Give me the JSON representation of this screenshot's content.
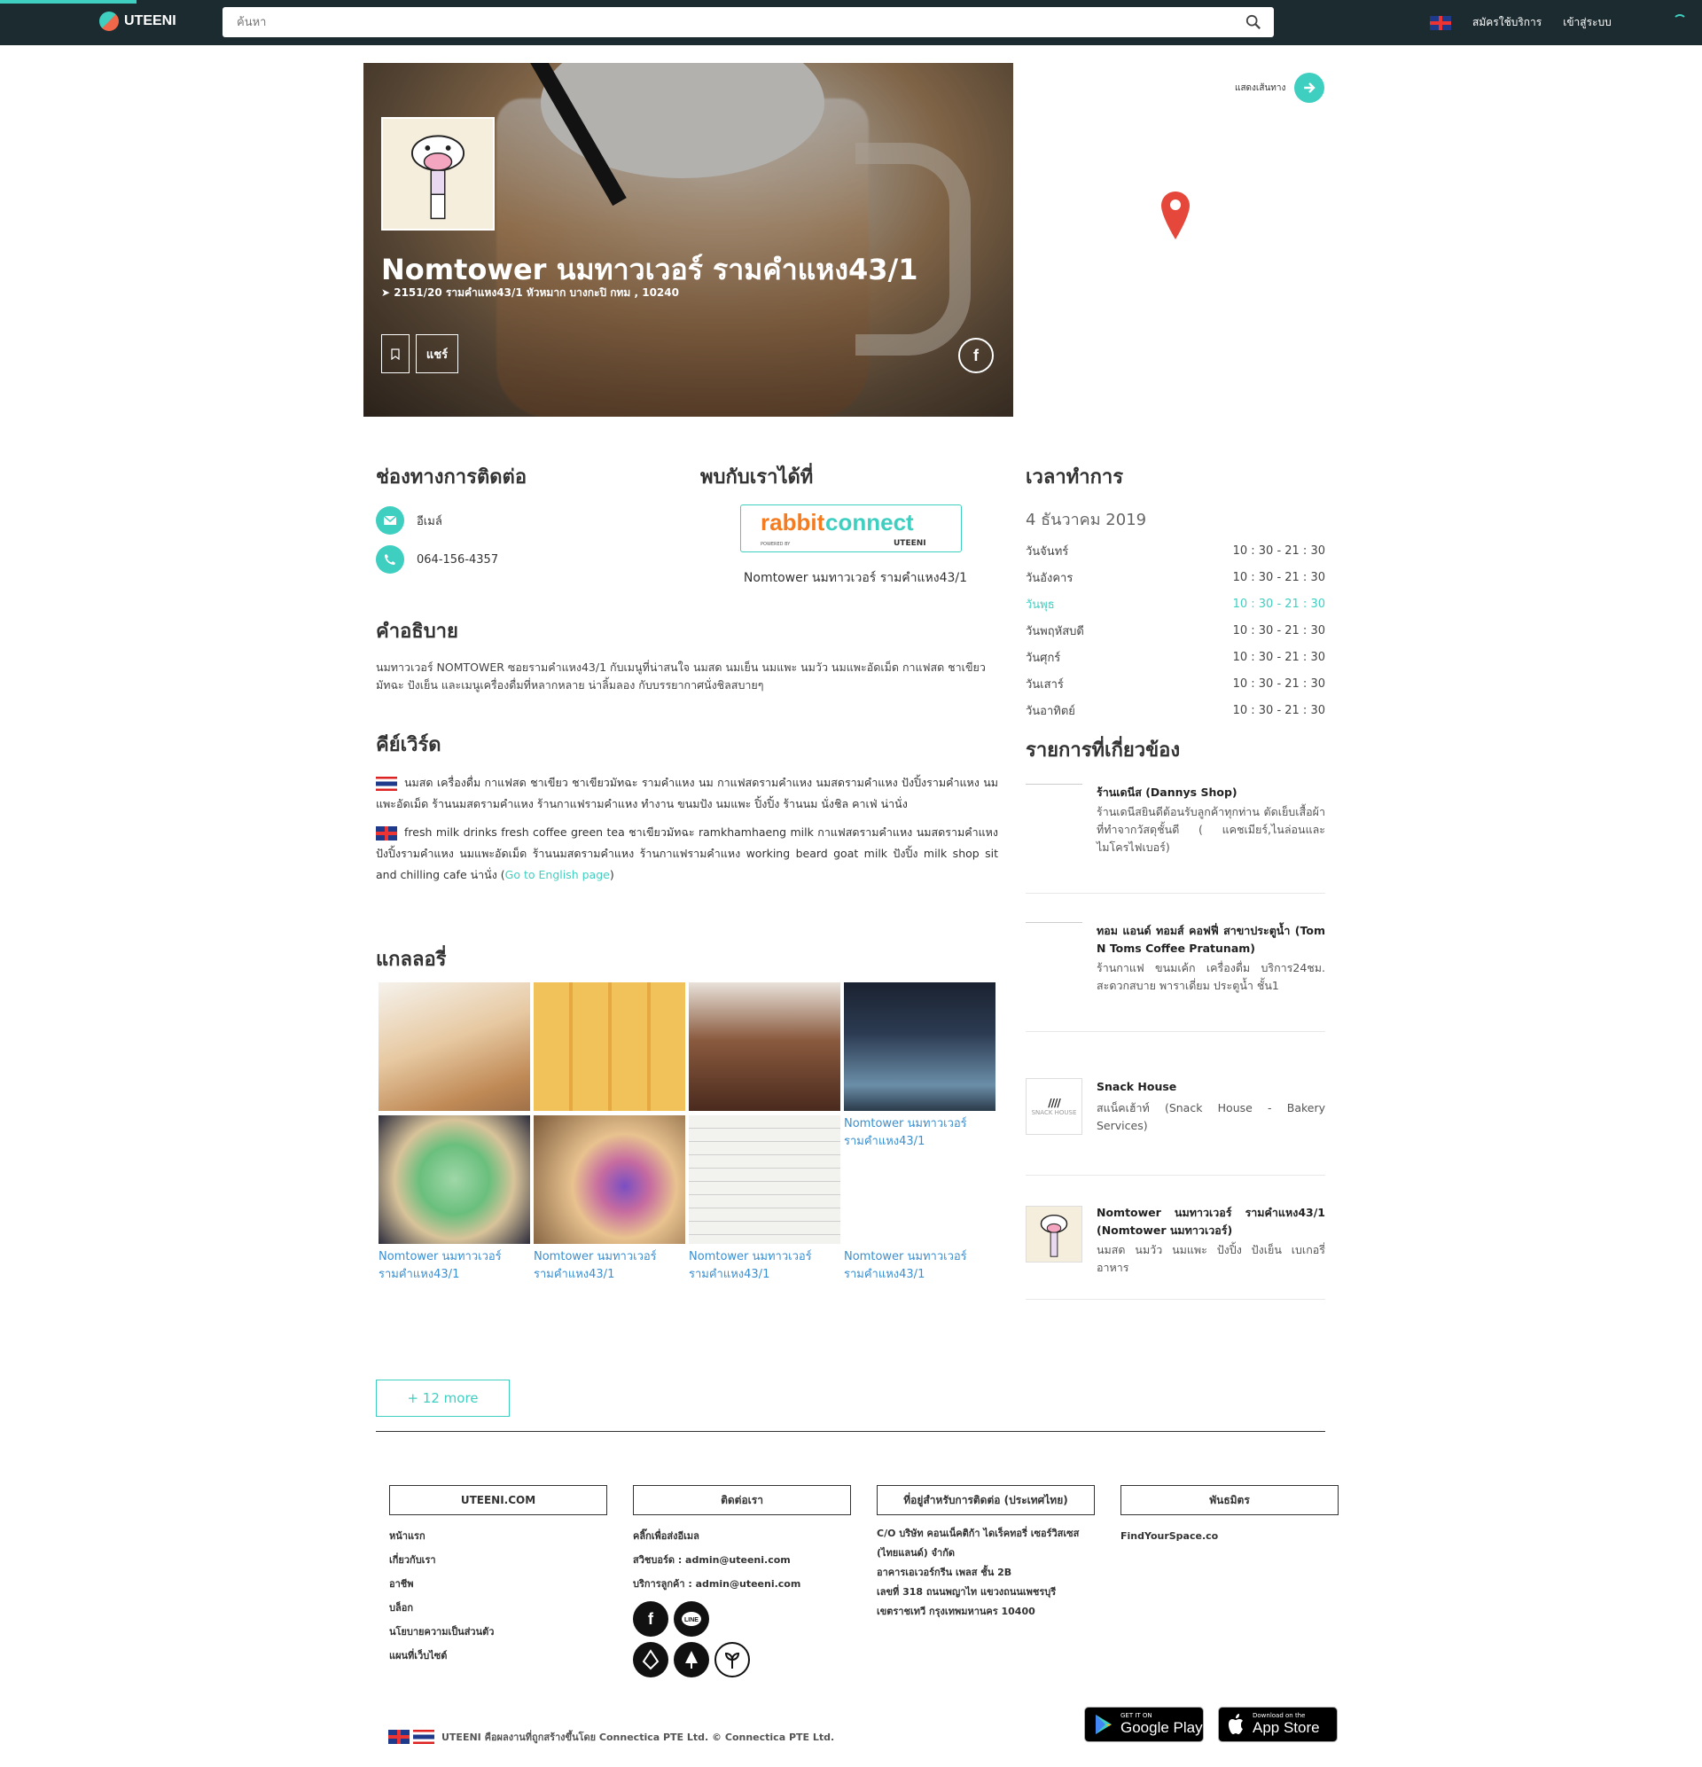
{
  "header": {
    "brand": "UTEENI",
    "search_placeholder": "ค้นหา",
    "register": "สมัครใช้บริการ",
    "login": "เข้าสู่ระบบ"
  },
  "colors": {
    "accent": "#3ecfc1",
    "topbar": "#1c2b30",
    "pin": "#e5483b"
  },
  "shop": {
    "name": "Nomtower นมทาวเวอร์ รามคำแหง43/1",
    "address": "2151/20 รามคำแหง43/1 หัวหมาก บางกะปิ กทม , 10240",
    "share": "แชร์",
    "fb_icon": "f"
  },
  "map": {
    "route_label": "แสดงเส้นทาง"
  },
  "contact": {
    "title": "ช่องทางการติดต่อ",
    "email_label": "อีเมล์",
    "phone": "064-156-4357"
  },
  "meet": {
    "title": "พบกับเราได้ที่",
    "logo_rabbit": "rabbit",
    "logo_connect": "connect",
    "logo_powered": "POWERED BY",
    "logo_uteeni": "UTEENI",
    "caption": "Nomtower นมทาวเวอร์ รามคำแหง43/1"
  },
  "description": {
    "title": "คำอธิบาย",
    "text": "นมทาวเวอร์ NOMTOWER ซอยรามคำแหง43/1 กับเมนูที่น่าสนใจ นมสด นมเย็น นมแพะ นมวัว นมแพะอัดเม็ด กาแฟสด ชาเขียวมัทฉะ ปังเย็น และเมนูเครื่องดื่มที่หลากหลาย น่าลิ้มลอง กับบรรยากาศนั่งชิลสบายๆ"
  },
  "keywords": {
    "title": "คีย์เวิร์ด",
    "thai": "นมสด เครื่องดื่ม กาแฟสด ชาเขียว ชาเขียวมัทฉะ รามคำแหง นม กาแฟสดรามคำแหง นมสดรามคำแหง ปังปิ้งรามคำแหง นมแพะอัดเม็ด ร้านนมสดรามคำแหง ร้านกาแฟรามคำแหง ทำงาน ขนมปัง นมแพะ ปิ้งปิ้ง ร้านนม นั่งชิล คาเฟ่ น่านั่ง",
    "english": "fresh milk drinks fresh coffee green tea ชาเขียวมัทฉะ ramkhamhaeng milk กาแฟสดรามคำแหง นมสดรามคำแหง ปังปิ้งรามคำแหง นมแพะอัดเม็ด ร้านนมสดรามคำแหง ร้านกาแฟรามคำแหง working beard goat milk ปังปิ้ง milk shop sit and chilling cafe น่านั่ง (",
    "english_link": "Go to English page",
    "english_tail": ")"
  },
  "gallery": {
    "title": "แกลลอรี่",
    "broken_alt": "Nomtower นมทาวเวอร์ รามคำแหง43/1",
    "more": "+ 12 more"
  },
  "hours": {
    "title": "เวลาทำการ",
    "date": "4 ธันวาคม 2019",
    "days": [
      {
        "day": "วันจันทร์",
        "time": "10 : 30 - 21 : 30"
      },
      {
        "day": "วันอังคาร",
        "time": "10 : 30 - 21 : 30"
      },
      {
        "day": "วันพุธ",
        "time": "10 : 30 - 21 : 30"
      },
      {
        "day": "วันพฤหัสบดี",
        "time": "10 : 30 - 21 : 30"
      },
      {
        "day": "วันศุกร์",
        "time": "10 : 30 - 21 : 30"
      },
      {
        "day": "วันเสาร์",
        "time": "10 : 30 - 21 : 30"
      },
      {
        "day": "วันอาทิตย์",
        "time": "10 : 30 - 21 : 30"
      }
    ]
  },
  "related": {
    "title": "รายการที่เกี่ยวข้อง",
    "items": [
      {
        "title": "ร้านเดนีส (Dannys Shop)",
        "desc": "ร้านเดนีสยินดีต้อนรับลูกค้าทุกท่าน ตัดเย็บเสื้อผ้าที่ทำจากวัสดุชั้นดี ( แคชเมียร์,ไนล่อนและไมโครไฟเบอร์)"
      },
      {
        "title": "ทอม แอนด์ ทอมส์ คอฟฟี่ สาขาประตูน้ำ (Tom N Toms Coffee Pratunam)",
        "desc": "ร้านกาแฟ ขนมเค้ก เครื่องดื่ม บริการ24ชม. สะดวกสบาย พาราเดี่ยม ประตูน้ำ ชั้น1"
      },
      {
        "title": "Snack House",
        "desc": "สแน็คเฮ้าท์ (Snack House - Bakery Services)",
        "thumb_text": "SNACK HOUSE"
      },
      {
        "title": "Nomtower นมทาวเวอร์ รามคำแหง43/1 (Nomtower นมทาวเวอร์)",
        "desc": "นมสด นมวัว นมแพะ ปังปิ้ง ปังเย็น เบเกอรี่ อาหาร"
      }
    ]
  },
  "footer": {
    "col1": {
      "title": "UTEENI.COM",
      "links": [
        "หน้าแรก",
        "เกี่ยวกับเรา",
        "อาชีพ",
        "บล็อก",
        "นโยบายความเป็นส่วนตัว",
        "แผนที่เว็บไซต์"
      ]
    },
    "col2": {
      "title": "ติดต่อเรา",
      "links": [
        "คลิ๊กเพื่อส่งอีเมล",
        "สวิชบอร์ด : admin@uteeni.com",
        "บริการลูกค้า : admin@uteeni.com"
      ]
    },
    "col3": {
      "title": "ที่อยู่สำหรับการติดต่อ (ประเทศไทย)",
      "lines": [
        "C/O บริษัท คอนเน็คติก้า ไดเร็คทอรี่ เซอร์วิสเซส",
        "(ไทยแลนด์) จำกัด",
        "อาคารเอเวอร์กรีน เพลส ชั้น 2B",
        "เลขที่ 318 ถนนพญาไท แขวงถนนเพชรบุรี",
        "เขตราชเทวี กรุงเทพมหานคร 10400"
      ]
    },
    "col4": {
      "title": "พันธมิตร",
      "links": [
        "FindYourSpace.co"
      ]
    },
    "copyright": "UTEENI คือผลงานที่ถูกสร้างขึ้นโดย Connectica PTE Ltd. © Connectica PTE Ltd.",
    "gplay_small": "GET IT ON",
    "gplay_big": "Google Play",
    "appstore_small": "Download on the",
    "appstore_big": "App Store"
  }
}
